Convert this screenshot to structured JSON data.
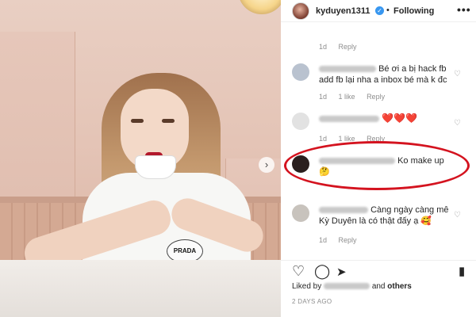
{
  "post": {
    "username": "kyduyen1311",
    "follow_status": "Following",
    "more_label": "•••",
    "shirt_logo": "PRADA"
  },
  "comments": [
    {
      "id": 0,
      "text": "",
      "age": "1d",
      "likes": "",
      "reply": "Reply"
    },
    {
      "id": 1,
      "text": "Bé ơi a bị hack fb add fb lại nha a inbox bé mà k đc",
      "age": "1d",
      "likes": "1 like",
      "reply": "Reply"
    },
    {
      "id": 2,
      "text": "❤️❤️❤️",
      "age": "1d",
      "likes": "1 like",
      "reply": "Reply"
    },
    {
      "id": 3,
      "text": "Ko make up 🤔",
      "age": "",
      "likes": "",
      "reply": ""
    },
    {
      "id": 4,
      "text": "Càng ngày càng mê Kỳ Duyên là có thật đấy ạ 🥰",
      "age": "1d",
      "likes": "",
      "reply": "Reply"
    }
  ],
  "actions": {
    "like_icon": "heart-outline-icon",
    "comment_icon": "comment-bubble-icon",
    "share_icon": "paper-plane-icon",
    "save_icon": "bookmark-icon"
  },
  "likes_summary": {
    "prefix": "Liked by",
    "suffix": "and",
    "others": "others"
  },
  "timestamp": "2 DAYS AGO",
  "colors": {
    "verified_blue": "#3897f0",
    "annotation_red": "#d4131f",
    "heart_red": "#e0262f"
  }
}
